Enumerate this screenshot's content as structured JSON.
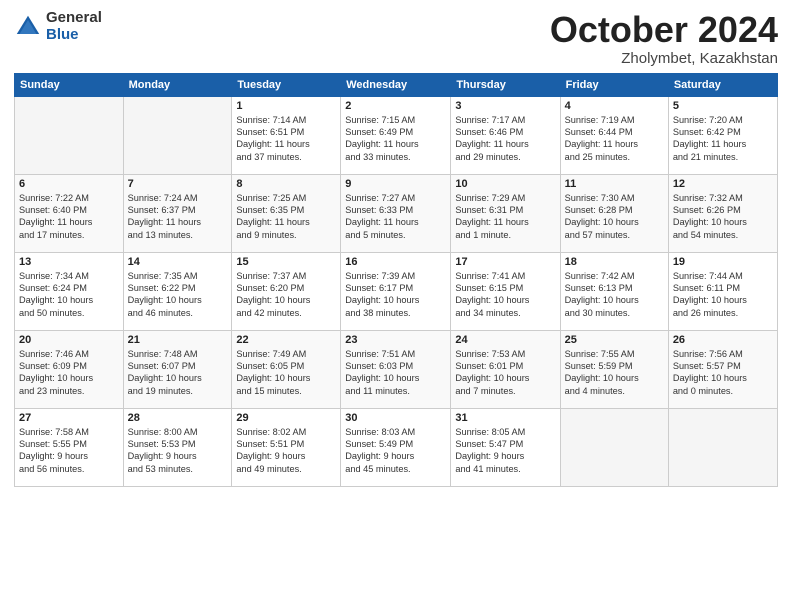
{
  "logo": {
    "general": "General",
    "blue": "Blue"
  },
  "title": "October 2024",
  "location": "Zholymbet, Kazakhstan",
  "days_header": [
    "Sunday",
    "Monday",
    "Tuesday",
    "Wednesday",
    "Thursday",
    "Friday",
    "Saturday"
  ],
  "weeks": [
    [
      {
        "day": "",
        "detail": ""
      },
      {
        "day": "",
        "detail": ""
      },
      {
        "day": "1",
        "detail": "Sunrise: 7:14 AM\nSunset: 6:51 PM\nDaylight: 11 hours\nand 37 minutes."
      },
      {
        "day": "2",
        "detail": "Sunrise: 7:15 AM\nSunset: 6:49 PM\nDaylight: 11 hours\nand 33 minutes."
      },
      {
        "day": "3",
        "detail": "Sunrise: 7:17 AM\nSunset: 6:46 PM\nDaylight: 11 hours\nand 29 minutes."
      },
      {
        "day": "4",
        "detail": "Sunrise: 7:19 AM\nSunset: 6:44 PM\nDaylight: 11 hours\nand 25 minutes."
      },
      {
        "day": "5",
        "detail": "Sunrise: 7:20 AM\nSunset: 6:42 PM\nDaylight: 11 hours\nand 21 minutes."
      }
    ],
    [
      {
        "day": "6",
        "detail": "Sunrise: 7:22 AM\nSunset: 6:40 PM\nDaylight: 11 hours\nand 17 minutes."
      },
      {
        "day": "7",
        "detail": "Sunrise: 7:24 AM\nSunset: 6:37 PM\nDaylight: 11 hours\nand 13 minutes."
      },
      {
        "day": "8",
        "detail": "Sunrise: 7:25 AM\nSunset: 6:35 PM\nDaylight: 11 hours\nand 9 minutes."
      },
      {
        "day": "9",
        "detail": "Sunrise: 7:27 AM\nSunset: 6:33 PM\nDaylight: 11 hours\nand 5 minutes."
      },
      {
        "day": "10",
        "detail": "Sunrise: 7:29 AM\nSunset: 6:31 PM\nDaylight: 11 hours\nand 1 minute."
      },
      {
        "day": "11",
        "detail": "Sunrise: 7:30 AM\nSunset: 6:28 PM\nDaylight: 10 hours\nand 57 minutes."
      },
      {
        "day": "12",
        "detail": "Sunrise: 7:32 AM\nSunset: 6:26 PM\nDaylight: 10 hours\nand 54 minutes."
      }
    ],
    [
      {
        "day": "13",
        "detail": "Sunrise: 7:34 AM\nSunset: 6:24 PM\nDaylight: 10 hours\nand 50 minutes."
      },
      {
        "day": "14",
        "detail": "Sunrise: 7:35 AM\nSunset: 6:22 PM\nDaylight: 10 hours\nand 46 minutes."
      },
      {
        "day": "15",
        "detail": "Sunrise: 7:37 AM\nSunset: 6:20 PM\nDaylight: 10 hours\nand 42 minutes."
      },
      {
        "day": "16",
        "detail": "Sunrise: 7:39 AM\nSunset: 6:17 PM\nDaylight: 10 hours\nand 38 minutes."
      },
      {
        "day": "17",
        "detail": "Sunrise: 7:41 AM\nSunset: 6:15 PM\nDaylight: 10 hours\nand 34 minutes."
      },
      {
        "day": "18",
        "detail": "Sunrise: 7:42 AM\nSunset: 6:13 PM\nDaylight: 10 hours\nand 30 minutes."
      },
      {
        "day": "19",
        "detail": "Sunrise: 7:44 AM\nSunset: 6:11 PM\nDaylight: 10 hours\nand 26 minutes."
      }
    ],
    [
      {
        "day": "20",
        "detail": "Sunrise: 7:46 AM\nSunset: 6:09 PM\nDaylight: 10 hours\nand 23 minutes."
      },
      {
        "day": "21",
        "detail": "Sunrise: 7:48 AM\nSunset: 6:07 PM\nDaylight: 10 hours\nand 19 minutes."
      },
      {
        "day": "22",
        "detail": "Sunrise: 7:49 AM\nSunset: 6:05 PM\nDaylight: 10 hours\nand 15 minutes."
      },
      {
        "day": "23",
        "detail": "Sunrise: 7:51 AM\nSunset: 6:03 PM\nDaylight: 10 hours\nand 11 minutes."
      },
      {
        "day": "24",
        "detail": "Sunrise: 7:53 AM\nSunset: 6:01 PM\nDaylight: 10 hours\nand 7 minutes."
      },
      {
        "day": "25",
        "detail": "Sunrise: 7:55 AM\nSunset: 5:59 PM\nDaylight: 10 hours\nand 4 minutes."
      },
      {
        "day": "26",
        "detail": "Sunrise: 7:56 AM\nSunset: 5:57 PM\nDaylight: 10 hours\nand 0 minutes."
      }
    ],
    [
      {
        "day": "27",
        "detail": "Sunrise: 7:58 AM\nSunset: 5:55 PM\nDaylight: 9 hours\nand 56 minutes."
      },
      {
        "day": "28",
        "detail": "Sunrise: 8:00 AM\nSunset: 5:53 PM\nDaylight: 9 hours\nand 53 minutes."
      },
      {
        "day": "29",
        "detail": "Sunrise: 8:02 AM\nSunset: 5:51 PM\nDaylight: 9 hours\nand 49 minutes."
      },
      {
        "day": "30",
        "detail": "Sunrise: 8:03 AM\nSunset: 5:49 PM\nDaylight: 9 hours\nand 45 minutes."
      },
      {
        "day": "31",
        "detail": "Sunrise: 8:05 AM\nSunset: 5:47 PM\nDaylight: 9 hours\nand 41 minutes."
      },
      {
        "day": "",
        "detail": ""
      },
      {
        "day": "",
        "detail": ""
      }
    ]
  ]
}
